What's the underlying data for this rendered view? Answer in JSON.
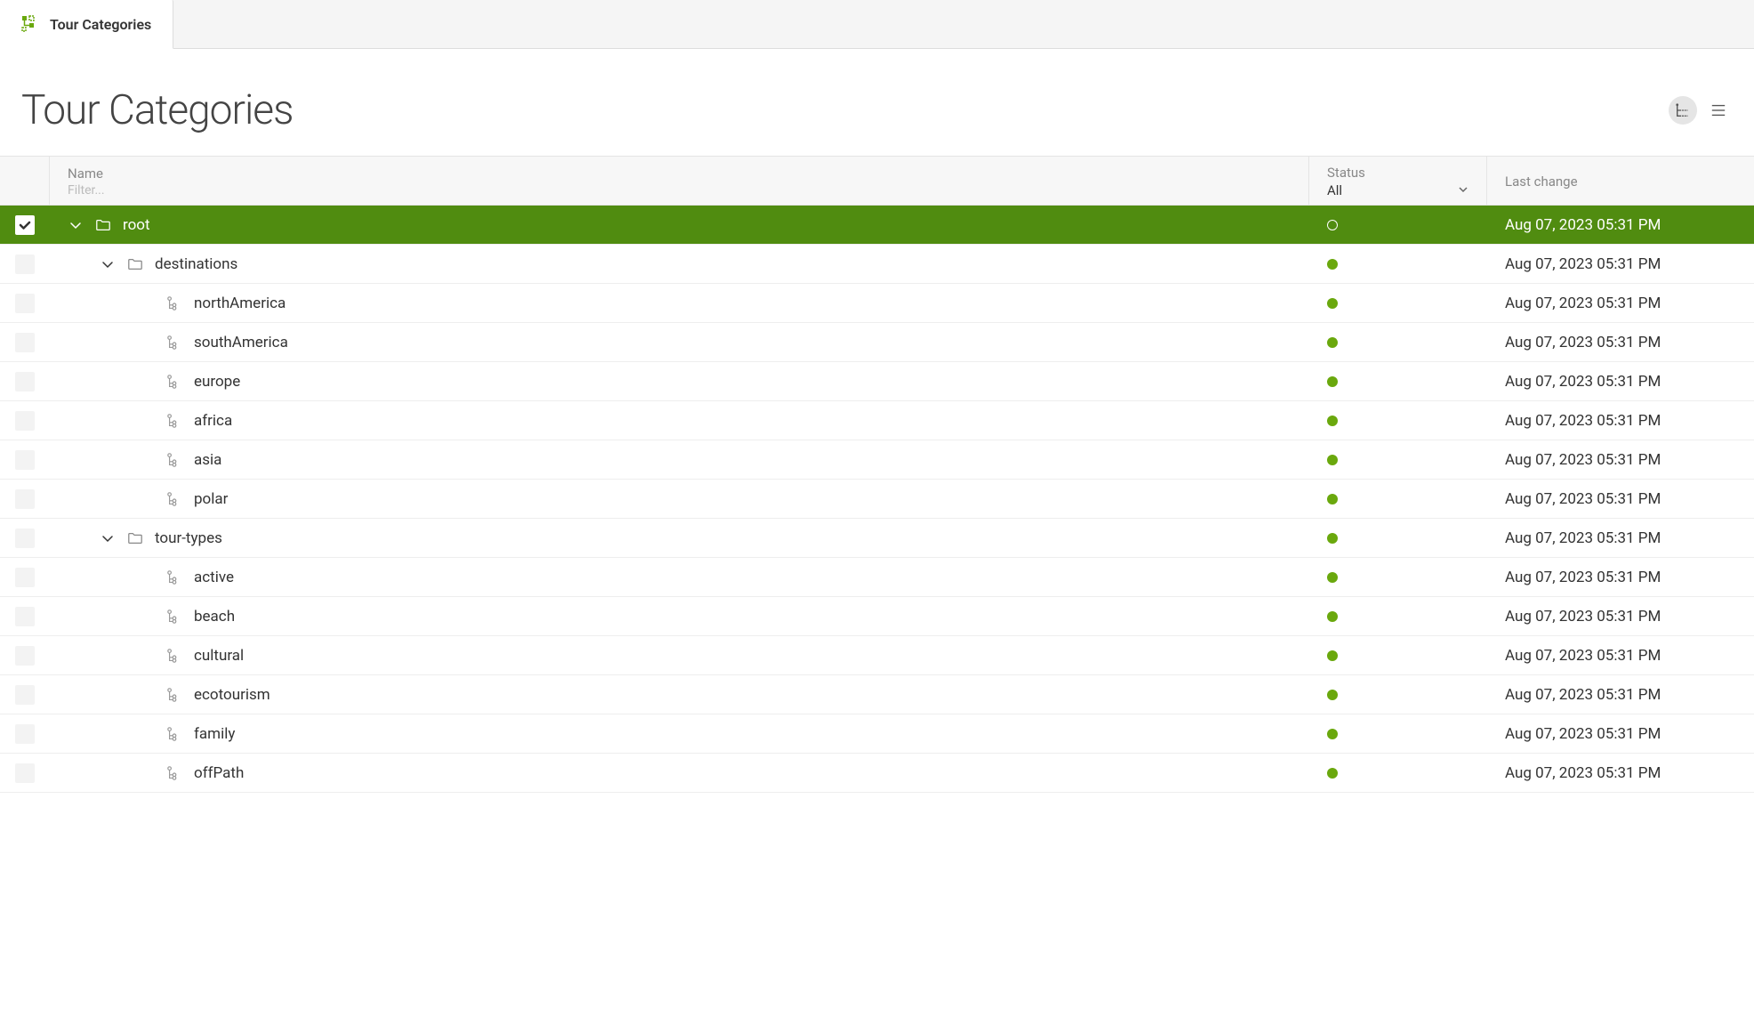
{
  "tab": {
    "title": "Tour Categories"
  },
  "page": {
    "title": "Tour Categories"
  },
  "columns": {
    "name": {
      "label": "Name",
      "filter_placeholder": "Filter..."
    },
    "status": {
      "label": "Status",
      "selected": "All"
    },
    "last_change": {
      "label": "Last change"
    }
  },
  "rows": [
    {
      "level": 0,
      "type": "folder",
      "expandable": true,
      "selected": true,
      "name": "root",
      "status": "draft",
      "last_change": "Aug 07, 2023 05:31 PM"
    },
    {
      "level": 1,
      "type": "folder",
      "expandable": true,
      "selected": false,
      "name": "destinations",
      "status": "published",
      "last_change": "Aug 07, 2023 05:31 PM"
    },
    {
      "level": 2,
      "type": "node",
      "expandable": false,
      "selected": false,
      "name": "northAmerica",
      "status": "published",
      "last_change": "Aug 07, 2023 05:31 PM"
    },
    {
      "level": 2,
      "type": "node",
      "expandable": false,
      "selected": false,
      "name": "southAmerica",
      "status": "published",
      "last_change": "Aug 07, 2023 05:31 PM"
    },
    {
      "level": 2,
      "type": "node",
      "expandable": false,
      "selected": false,
      "name": "europe",
      "status": "published",
      "last_change": "Aug 07, 2023 05:31 PM"
    },
    {
      "level": 2,
      "type": "node",
      "expandable": false,
      "selected": false,
      "name": "africa",
      "status": "published",
      "last_change": "Aug 07, 2023 05:31 PM"
    },
    {
      "level": 2,
      "type": "node",
      "expandable": false,
      "selected": false,
      "name": "asia",
      "status": "published",
      "last_change": "Aug 07, 2023 05:31 PM"
    },
    {
      "level": 2,
      "type": "node",
      "expandable": false,
      "selected": false,
      "name": "polar",
      "status": "published",
      "last_change": "Aug 07, 2023 05:31 PM"
    },
    {
      "level": 1,
      "type": "folder",
      "expandable": true,
      "selected": false,
      "name": "tour-types",
      "status": "published",
      "last_change": "Aug 07, 2023 05:31 PM"
    },
    {
      "level": 2,
      "type": "node",
      "expandable": false,
      "selected": false,
      "name": "active",
      "status": "published",
      "last_change": "Aug 07, 2023 05:31 PM"
    },
    {
      "level": 2,
      "type": "node",
      "expandable": false,
      "selected": false,
      "name": "beach",
      "status": "published",
      "last_change": "Aug 07, 2023 05:31 PM"
    },
    {
      "level": 2,
      "type": "node",
      "expandable": false,
      "selected": false,
      "name": "cultural",
      "status": "published",
      "last_change": "Aug 07, 2023 05:31 PM"
    },
    {
      "level": 2,
      "type": "node",
      "expandable": false,
      "selected": false,
      "name": "ecotourism",
      "status": "published",
      "last_change": "Aug 07, 2023 05:31 PM"
    },
    {
      "level": 2,
      "type": "node",
      "expandable": false,
      "selected": false,
      "name": "family",
      "status": "published",
      "last_change": "Aug 07, 2023 05:31 PM"
    },
    {
      "level": 2,
      "type": "node",
      "expandable": false,
      "selected": false,
      "name": "offPath",
      "status": "published",
      "last_change": "Aug 07, 2023 05:31 PM"
    }
  ]
}
